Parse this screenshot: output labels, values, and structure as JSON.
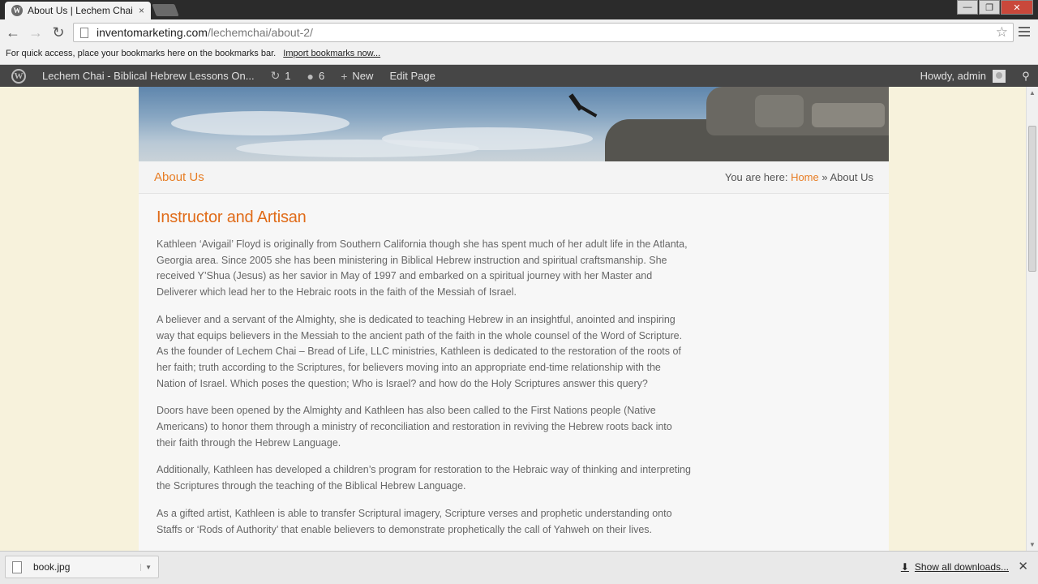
{
  "browser": {
    "tab_title": "About Us | Lechem Chai –",
    "tab_close": "×",
    "url_host": "inventomarketing.com",
    "url_path": "/lechemchai/about-2/",
    "bookmarks_prompt": "For quick access, place your bookmarks here on the bookmarks bar.",
    "import_bookmarks": "Import bookmarks now...",
    "window_controls": {
      "minimize": "—",
      "maximize": "❐",
      "close": "✕"
    }
  },
  "adminbar": {
    "site_name": "Lechem Chai - Biblical Hebrew Lessons On...",
    "updates_count": "1",
    "comments_count": "6",
    "new_label": "New",
    "edit_label": "Edit Page",
    "howdy": "Howdy, admin"
  },
  "page": {
    "title": "About Us",
    "breadcrumb": {
      "prefix": "You are here:",
      "home": "Home",
      "separator": "»",
      "current": "About Us"
    },
    "heading": "Instructor and Artisan",
    "paragraphs": [
      "Kathleen ‘Avigail’ Floyd is originally from Southern California though she has spent much of her adult life in the Atlanta, Georgia area. Since 2005 she has been ministering in Biblical Hebrew instruction and spiritual craftsmanship. She received Y’Shua (Jesus) as her savior in May of 1997 and embarked on a spiritual journey with her Master and Deliverer which lead her to the Hebraic roots in the faith of the Messiah of Israel.",
      "A believer and a servant of the Almighty, she is dedicated to teaching Hebrew in an insightful, anointed and inspiring way that equips believers in the Messiah to the ancient path of the faith in the whole counsel of the Word of Scripture. As the founder of Lechem Chai – Bread of Life, LLC ministries, Kathleen is dedicated to the restoration of the roots of her faith; truth according to the Scriptures, for believers moving into an appropriate end-time relationship with the Nation of Israel. Which poses the question; Who is Israel? and how do the Holy Scriptures answer this query?",
      "Doors have been opened by the Almighty and Kathleen has also been called to the First Nations people (Native Americans) to honor them through a ministry of reconciliation and restoration in reviving the Hebrew roots back into their faith through the Hebrew Language.",
      "Additionally, Kathleen has developed a children’s program for restoration to the Hebraic way of thinking and interpreting the Scriptures through the teaching of the Biblical Hebrew Language.",
      "As a gifted artist, Kathleen is able to transfer Scriptural imagery, Scripture verses and prophetic understanding onto Staffs or ‘Rods of Authority’ that enable believers to demonstrate prophetically the call of Yahweh on their lives."
    ]
  },
  "downloads": {
    "file_name": "book.jpg",
    "show_all": "Show all downloads...",
    "close": "✕"
  },
  "colors": {
    "accent": "#e77d24",
    "adminbar": "#464646",
    "page_bg": "#f7f2dc"
  }
}
